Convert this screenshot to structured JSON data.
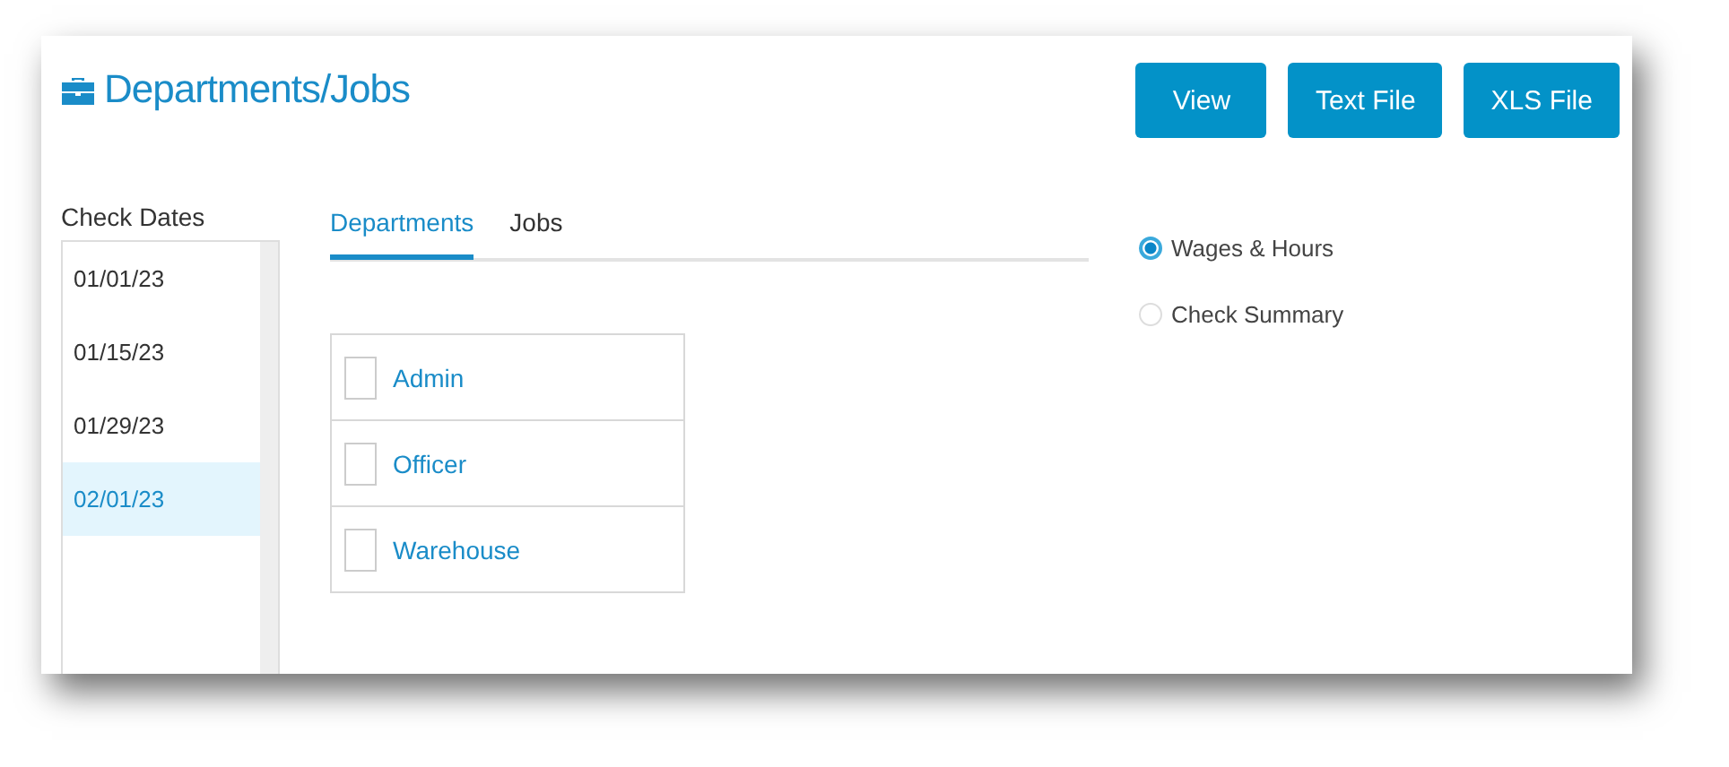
{
  "header": {
    "title": "Departments/Jobs",
    "buttons": [
      "View",
      "Text File",
      "XLS File"
    ]
  },
  "check_dates": {
    "label": "Check Dates",
    "items": [
      {
        "text": "01/01/23",
        "selected": false
      },
      {
        "text": "01/15/23",
        "selected": false
      },
      {
        "text": "01/29/23",
        "selected": false
      },
      {
        "text": "02/01/23",
        "selected": true
      }
    ]
  },
  "tabs": [
    {
      "label": "Departments",
      "selected": true
    },
    {
      "label": "Jobs",
      "selected": false
    }
  ],
  "items": [
    {
      "label": "Admin",
      "checked": false
    },
    {
      "label": "Officer",
      "checked": false
    },
    {
      "label": "Warehouse",
      "checked": false
    }
  ],
  "report_types": [
    {
      "label": "Wages & Hours",
      "selected": true
    },
    {
      "label": "Check Summary",
      "selected": false
    }
  ]
}
